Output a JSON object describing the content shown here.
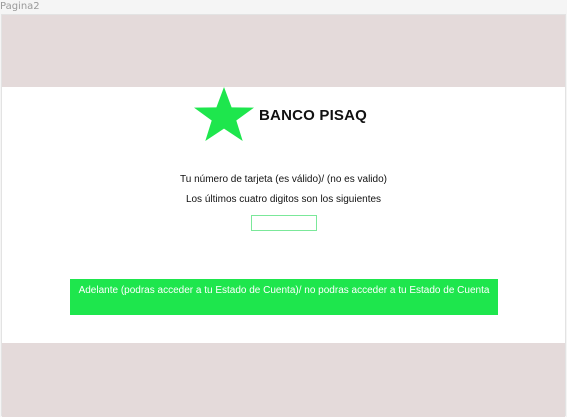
{
  "frame": {
    "label": "Pagina2"
  },
  "bank": {
    "logo_icon": "star-icon",
    "name": "BANCO PISAQ"
  },
  "messages": {
    "card_status": "Tu número de tarjeta (es válido)/ (no es valido)",
    "last_digits": "Los últimos cuatro digitos son los siguientes"
  },
  "digits_field": {
    "value": ""
  },
  "continue_button": {
    "label": "Adelante (podras acceder a tu Estado de Cuenta)/ no podras acceder a tu Estado de Cuenta"
  },
  "colors": {
    "accent_green": "#1ee64d",
    "band": "#e4dada",
    "input_border": "#7be89a"
  }
}
